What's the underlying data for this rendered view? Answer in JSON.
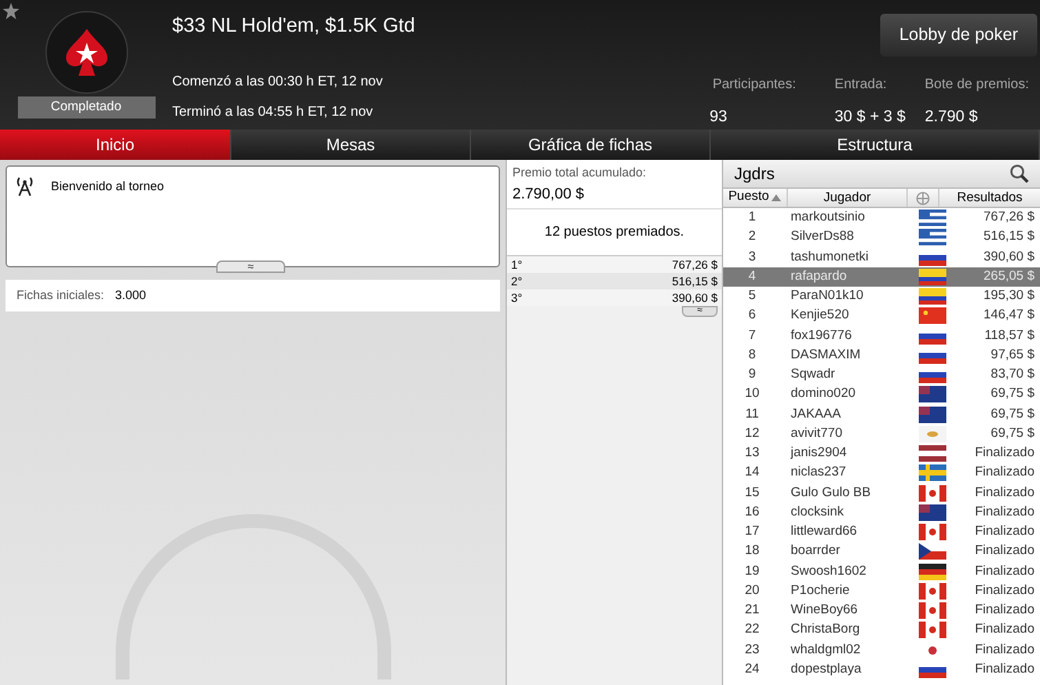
{
  "header": {
    "title": "$33 NL Hold'em, $1.5K Gtd",
    "started": "Comenzó a las 00:30 h ET, 12 nov",
    "ended": "Terminó a las 04:55 h ET, 12 nov",
    "status": "Completado",
    "lobby_button": "Lobby de poker",
    "stats": [
      {
        "label": "Participantes:",
        "value": "93"
      },
      {
        "label": "Entrada:",
        "value": "30 $ + 3 $"
      },
      {
        "label": "Bote de premios:",
        "value": "2.790 $"
      }
    ]
  },
  "tabs": [
    {
      "label": "Inicio",
      "selected": true
    },
    {
      "label": "Mesas",
      "selected": false
    },
    {
      "label": "Gráfica de fichas",
      "selected": false
    },
    {
      "label": "Estructura",
      "selected": false
    }
  ],
  "messages": {
    "text": "Bienvenido al torneo",
    "collapse": "≈"
  },
  "starting_chips": {
    "label": "Fichas iniciales:",
    "value": "3.000"
  },
  "prizes": {
    "label": "Premio total acumulado:",
    "total": "2.790,00 $",
    "paid": "12 puestos premiados.",
    "expand": "≈",
    "rows": [
      {
        "place": "1°",
        "amount": "767,26 $"
      },
      {
        "place": "2°",
        "amount": "516,15 $"
      },
      {
        "place": "3°",
        "amount": "390,60 $"
      }
    ]
  },
  "players": {
    "title": "Jgdrs",
    "columns": [
      "Puesto",
      "Jugador",
      "Resultados"
    ],
    "rows": [
      {
        "place": "1",
        "name": "markoutsinio",
        "kind": "greece",
        "result": "767,26 $",
        "selected": false
      },
      {
        "place": "2",
        "name": "SilverDs88",
        "kind": "greece",
        "result": "516,15 $",
        "selected": false
      },
      {
        "place": "3",
        "name": "tashumonetki",
        "kind": "russia",
        "result": "390,60 $",
        "selected": false
      },
      {
        "place": "4",
        "name": "rafapardo",
        "kind": "colombia",
        "result": "265,05 $",
        "selected": true
      },
      {
        "place": "5",
        "name": "ParaN01k10",
        "kind": "colombia",
        "result": "195,30 $",
        "selected": false
      },
      {
        "place": "6",
        "name": "Kenjie520",
        "kind": "china",
        "result": "146,47 $",
        "selected": false
      },
      {
        "place": "7",
        "name": "fox196776",
        "kind": "russia",
        "result": "118,57 $",
        "selected": false
      },
      {
        "place": "8",
        "name": "DASMAXIM",
        "kind": "russia",
        "result": "97,65 $",
        "selected": false
      },
      {
        "place": "9",
        "name": "Sqwadr",
        "kind": "russia",
        "result": "83,70 $",
        "selected": false
      },
      {
        "place": "10",
        "name": "domino020",
        "kind": "australia",
        "result": "69,75 $",
        "selected": false
      },
      {
        "place": "11",
        "name": "JAKAAA",
        "kind": "australia",
        "result": "69,75 $",
        "selected": false
      },
      {
        "place": "12",
        "name": "avivit770",
        "kind": "cyprus",
        "result": "69,75 $",
        "selected": false
      },
      {
        "place": "13",
        "name": "janis2904",
        "kind": "latvia",
        "result": "Finalizado",
        "selected": false
      },
      {
        "place": "14",
        "name": "niclas237",
        "kind": "sweden",
        "result": "Finalizado",
        "selected": false
      },
      {
        "place": "15",
        "name": "Gulo Gulo BB",
        "kind": "canada",
        "result": "Finalizado",
        "selected": false
      },
      {
        "place": "16",
        "name": "clocksink",
        "kind": "australia",
        "result": "Finalizado",
        "selected": false
      },
      {
        "place": "17",
        "name": "littleward66",
        "kind": "canada",
        "result": "Finalizado",
        "selected": false
      },
      {
        "place": "18",
        "name": "boarrder",
        "kind": "czech",
        "result": "Finalizado",
        "selected": false
      },
      {
        "place": "19",
        "name": "Swoosh1602",
        "kind": "germany",
        "result": "Finalizado",
        "selected": false
      },
      {
        "place": "20",
        "name": "P1ocherie",
        "kind": "canada",
        "result": "Finalizado",
        "selected": false
      },
      {
        "place": "21",
        "name": "WineBoy66",
        "kind": "canada",
        "result": "Finalizado",
        "selected": false
      },
      {
        "place": "22",
        "name": "ChristaBorg",
        "kind": "canada",
        "result": "Finalizado",
        "selected": false
      },
      {
        "place": "23",
        "name": "whaldgml02",
        "kind": "korea",
        "result": "Finalizado",
        "selected": false
      },
      {
        "place": "24",
        "name": "dopestplaya",
        "kind": "russia",
        "result": "Finalizado",
        "selected": false
      }
    ]
  }
}
